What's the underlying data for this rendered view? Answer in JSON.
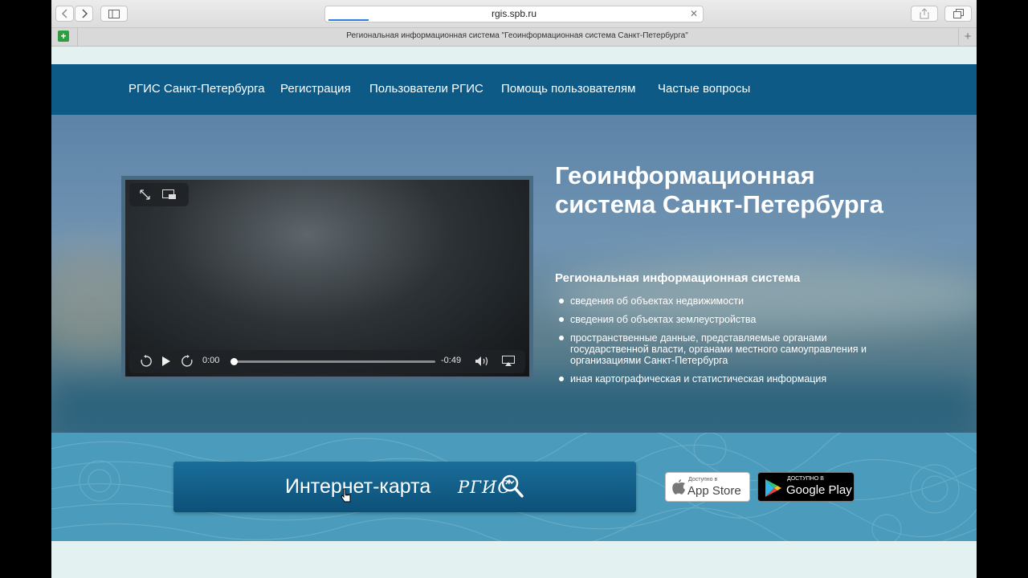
{
  "browser": {
    "url": "rgis.spb.ru",
    "tab_title": "Региональная информационная система \"Геоинформационная система Санкт-Петербурга\""
  },
  "nav": {
    "items": [
      {
        "label": "РГИС Санкт-Петербурга"
      },
      {
        "label": "Регистрация"
      },
      {
        "label": "Пользователи РГИС"
      },
      {
        "label": "Помощь пользователям"
      },
      {
        "label": "Частые вопросы"
      }
    ]
  },
  "video": {
    "current_time": "0:00",
    "remaining_time": "-0:49",
    "progress": 0,
    "skip_seconds": "15"
  },
  "hero": {
    "title": "Геоинформационная система Санкт-Петербурга",
    "subtitle": "Региональная информационная система",
    "bullets": [
      "сведения об объектах недвижимости",
      "сведения об объектах землеустройства",
      "пространственные данные, представляемые органами государственной власти, органами местного самоуправления и организациями Санкт-Петербурга",
      "иная картографическая и статистическая информация"
    ]
  },
  "map_button": {
    "label": "Интернет-карта",
    "logo_text": "РГИС"
  },
  "stores": {
    "appstore": {
      "small": "Доступно в",
      "big": "App Store"
    },
    "googleplay": {
      "small": "ДОСТУПНО В",
      "big": "Google Play"
    }
  },
  "colors": {
    "nav_bg": "#0c5a85",
    "band_bg": "#4b9cbc",
    "button_bg": "#0c5078",
    "page_bg": "#e4f1f1"
  }
}
